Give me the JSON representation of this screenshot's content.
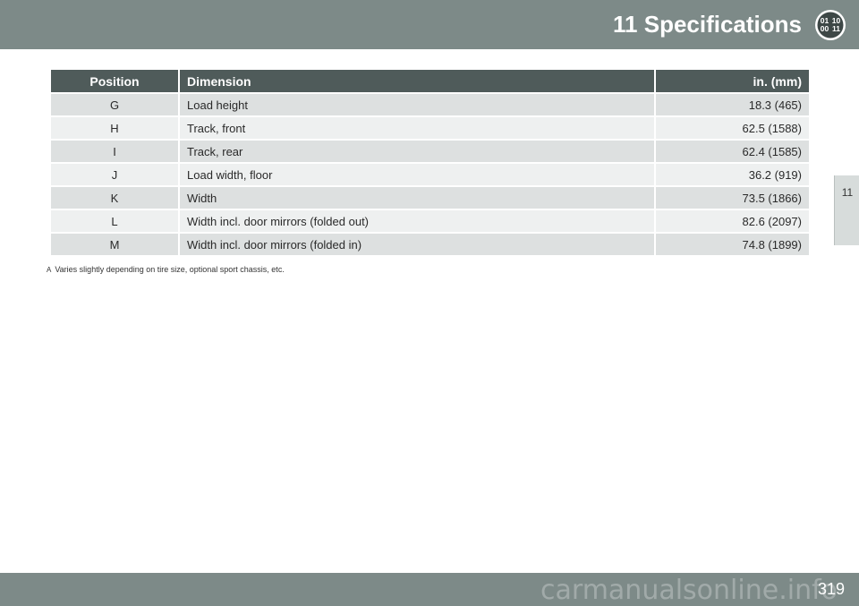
{
  "header": {
    "title": "11 Specifications",
    "icon_digits": [
      "01",
      "10",
      "00",
      "11"
    ]
  },
  "side_tab": {
    "label": "11"
  },
  "table": {
    "columns": [
      "Position",
      "Dimension",
      "in. (mm)"
    ],
    "rows": [
      {
        "position": "G",
        "dimension": "Load height",
        "value": "18.3 (465)"
      },
      {
        "position": "H",
        "dimension": "Track, front",
        "value": "62.5 (1588)"
      },
      {
        "position": "I",
        "dimension": "Track, rear",
        "value": "62.4 (1585)"
      },
      {
        "position": "J",
        "dimension": "Load width, floor",
        "value": "36.2 (919)"
      },
      {
        "position": "K",
        "dimension": "Width",
        "value": "73.5 (1866)"
      },
      {
        "position": "L",
        "dimension": "Width incl. door mirrors (folded out)",
        "value": "82.6 (2097)"
      },
      {
        "position": "M",
        "dimension": "Width incl. door mirrors (folded in)",
        "value": "74.8 (1899)"
      }
    ]
  },
  "footnote": {
    "mark": "A",
    "text": "Varies slightly depending on tire size, optional sport chassis, etc."
  },
  "footer": {
    "page_number": "319"
  },
  "watermark": {
    "text": "carmanualsonline.info"
  },
  "colors": {
    "header_bg": "#7d8a88",
    "table_header_bg": "#4f5b5a",
    "row_odd_bg": "#dde0e0",
    "row_even_bg": "#eef0f0"
  }
}
